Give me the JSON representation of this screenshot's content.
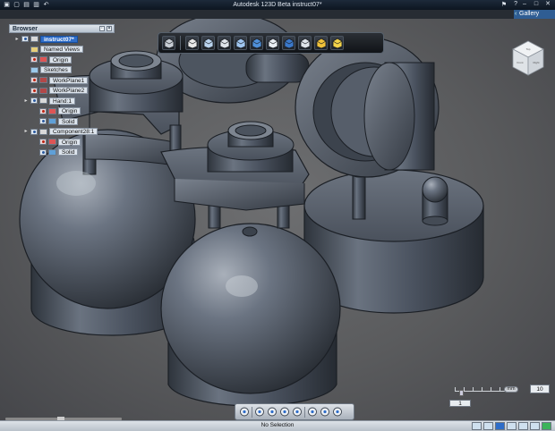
{
  "titlebar": {
    "title": "Autodesk 123D Beta   instruct07*",
    "quick_access": [
      "app-menu-icon",
      "new-icon",
      "save-icon",
      "print-icon",
      "undo-icon"
    ],
    "right_icons": [
      "sign-in-icon",
      "help-icon"
    ],
    "window_controls": [
      "minimize-icon",
      "maximize-icon",
      "close-icon"
    ]
  },
  "gallery": {
    "label": "Gallery"
  },
  "browser": {
    "header": "Browser",
    "items": [
      {
        "label": "instruct07*",
        "indent": 0,
        "icon": "comp",
        "visible": true,
        "root": true
      },
      {
        "label": "Named Views",
        "indent": 1,
        "icon": "folder",
        "visible": null
      },
      {
        "label": "Origin",
        "indent": 1,
        "icon": "origin",
        "visible": false
      },
      {
        "label": "Sketches",
        "indent": 1,
        "icon": "sketch",
        "visible": null
      },
      {
        "label": "WorkPlane1",
        "indent": 1,
        "icon": "plane",
        "visible": false
      },
      {
        "label": "WorkPlane2",
        "indent": 1,
        "icon": "plane",
        "visible": false
      },
      {
        "label": "Hand:1",
        "indent": 1,
        "icon": "comp",
        "visible": true
      },
      {
        "label": "Origin",
        "indent": 2,
        "icon": "origin",
        "visible": false
      },
      {
        "label": "Solid",
        "indent": 2,
        "icon": "solid",
        "visible": true
      },
      {
        "label": "Component28:1",
        "indent": 1,
        "icon": "comp",
        "visible": true
      },
      {
        "label": "Origin",
        "indent": 2,
        "icon": "origin",
        "visible": false
      },
      {
        "label": "Solid",
        "indent": 2,
        "icon": "solid",
        "visible": true
      }
    ]
  },
  "toolbar": {
    "buttons": [
      "primitives-icon",
      "sketch-icon",
      "construct-icon",
      "modify-icon",
      "pattern-icon",
      "grouping-icon",
      "combine-icon",
      "measure-icon",
      "text-icon",
      "material-icon",
      "snap-icon"
    ]
  },
  "viewcube": {
    "top": "Top",
    "front": "Front",
    "right": "Right"
  },
  "navbar": {
    "buttons": [
      "steering-wheel-icon",
      "pan-icon",
      "orbit-icon",
      "zoom-icon",
      "look-at-icon",
      "fit-icon",
      "view-icon",
      "zoom-window-icon"
    ]
  },
  "snap": {
    "unit": "mm",
    "grid_value": "10",
    "snap_value": "1"
  },
  "status": {
    "text": "No Selection"
  },
  "colors": {
    "model": "#5b6472",
    "background": "#5e5f61",
    "root_highlight": "#2e6dc9",
    "gallery": "#2f5d93"
  }
}
